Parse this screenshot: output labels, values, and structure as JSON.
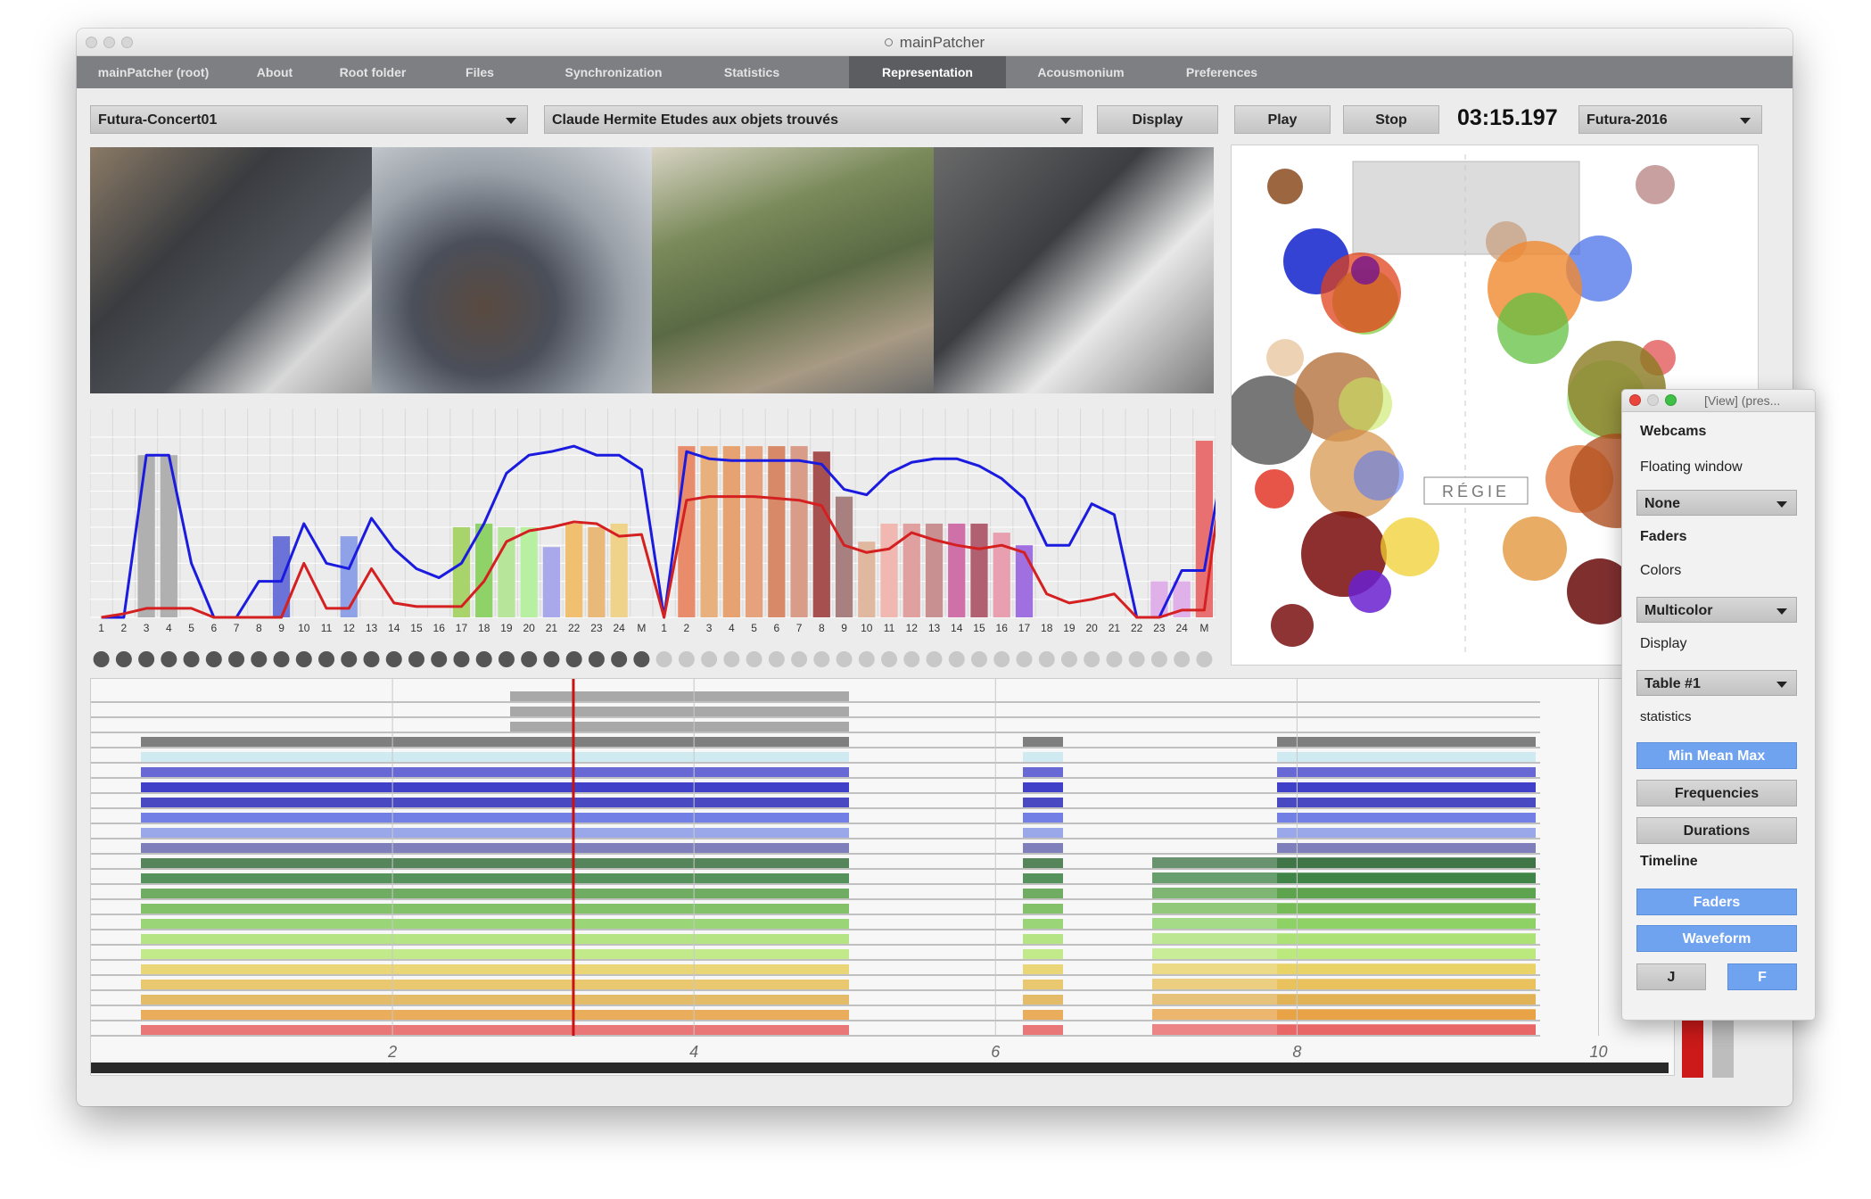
{
  "window": {
    "title": "mainPatcher"
  },
  "tabs": [
    "mainPatcher (root)",
    "About",
    "Root folder",
    "Files",
    "Synchronization",
    "Statistics",
    "Representation",
    "Acousmonium",
    "Preferences"
  ],
  "active_tab": "Representation",
  "toolbar": {
    "concert": "Futura-Concert01",
    "piece": "Claude Hermite Etudes aux objets trouvés",
    "display_label": "Display",
    "play_label": "Play",
    "stop_label": "Stop",
    "time": "03:15.197",
    "festival": "Futura-2016"
  },
  "chart_data": {
    "type": "line",
    "categories": [
      "1",
      "2",
      "3",
      "4",
      "5",
      "6",
      "7",
      "8",
      "9",
      "10",
      "11",
      "12",
      "13",
      "14",
      "15",
      "16",
      "17",
      "18",
      "19",
      "20",
      "21",
      "22",
      "23",
      "24",
      "M",
      "1",
      "2",
      "3",
      "4",
      "5",
      "6",
      "7",
      "8",
      "9",
      "10",
      "11",
      "12",
      "13",
      "14",
      "15",
      "16",
      "17",
      "18",
      "19",
      "20",
      "21",
      "22",
      "23",
      "24",
      "M"
    ],
    "series": [
      {
        "color": "#1b1be0",
        "values": [
          0,
          0,
          0.9,
          0.9,
          0.3,
          0,
          0,
          0.2,
          0.2,
          0.52,
          0.3,
          0.27,
          0.55,
          0.38,
          0.27,
          0.22,
          0.3,
          0.52,
          0.8,
          0.9,
          0.92,
          0.95,
          0.9,
          0.9,
          0.82,
          0,
          0.92,
          0.88,
          0.87,
          0.87,
          0.87,
          0.87,
          0.85,
          0.71,
          0.68,
          0.8,
          0.86,
          0.88,
          0.88,
          0.84,
          0.77,
          0.66,
          0.4,
          0.4,
          0.63,
          0.57,
          0,
          0,
          0.26,
          0.26,
          0.98
        ]
      },
      {
        "color": "#d42020",
        "values": [
          0,
          0.02,
          0.05,
          0.05,
          0.05,
          0,
          0,
          0,
          0,
          0.3,
          0.05,
          0.05,
          0.27,
          0.08,
          0.06,
          0.06,
          0.06,
          0.2,
          0.42,
          0.48,
          0.5,
          0.53,
          0.52,
          0.45,
          0.46,
          0,
          0.65,
          0.67,
          0.67,
          0.67,
          0.66,
          0.65,
          0.62,
          0.4,
          0.36,
          0.38,
          0.47,
          0.43,
          0.4,
          0.38,
          0.4,
          0.36,
          0.13,
          0.08,
          0.1,
          0.13,
          0,
          0,
          0.04,
          0.04,
          0.98
        ]
      }
    ],
    "bars": [
      0,
      0,
      0.9,
      0.9,
      0,
      0,
      0,
      0,
      0.45,
      0,
      0,
      0.45,
      0,
      0,
      0,
      0,
      0.5,
      0.52,
      0.5,
      0.5,
      0.39,
      0.52,
      0.5,
      0.52,
      0,
      0,
      0.95,
      0.95,
      0.95,
      0.95,
      0.95,
      0.95,
      0.92,
      0.67,
      0.42,
      0.52,
      0.52,
      0.52,
      0.52,
      0.52,
      0.47,
      0.4,
      0,
      0,
      0,
      0,
      0,
      0.2,
      0.2,
      0.98
    ],
    "bar_colors": [
      "#aaa",
      "#aaa",
      "#b0b0b0",
      "#b0b0b0",
      "#aaa",
      "#aaa",
      "#aaa",
      "#aaa",
      "#6c73d8",
      "#aaa",
      "#aaa",
      "#8fa2e8",
      "#aaa",
      "#aaa",
      "#aaa",
      "#aaa",
      "#a9d36b",
      "#8fd268",
      "#b7e69a",
      "#b8f0a2",
      "#a8a8ea",
      "#f0c070",
      "#e8b978",
      "#f0d38a",
      "#aaa",
      "#aaa",
      "#e98c6c",
      "#e8b07c",
      "#e6a270",
      "#e6a27c",
      "#d88a68",
      "#d89c88",
      "#a65050",
      "#a88080",
      "#e0b8a0",
      "#f0b8b0",
      "#e0a0a0",
      "#c89090",
      "#d070a8",
      "#b06070",
      "#e8a0b0",
      "#a070e0",
      "#aaa",
      "#aaa",
      "#aaa",
      "#aaa",
      "#aaa",
      "#e0b0e8",
      "#e0b0e8",
      "#e87070"
    ],
    "active_points": 25,
    "ylim": [
      0,
      1
    ]
  },
  "map": {
    "label": "RÉGIE"
  },
  "timeline": {
    "ticks": [
      "2",
      "4",
      "6",
      "8",
      "10"
    ],
    "playhead_seconds": 3.2,
    "x_range": [
      0,
      10.5
    ]
  },
  "panel": {
    "title": "[View] (pres...",
    "webcams_heading": "Webcams",
    "floating_label": "Floating window",
    "floating_value": "None",
    "faders_heading": "Faders",
    "colors_label": "Colors",
    "colors_value": "Multicolor",
    "display_label": "Display",
    "display_value": "Table #1",
    "statistics_label": "statistics",
    "btn_minmeanmax": "Min Mean Max",
    "btn_frequencies": "Frequencies",
    "btn_durations": "Durations",
    "timeline_heading": "Timeline",
    "btn_faders": "Faders",
    "btn_waveform": "Waveform",
    "btn_j": "J",
    "btn_f": "F"
  },
  "colors": {
    "tabbar": "#7d7f83",
    "active_tab": "#5b5d61",
    "accent_blue": "#6fa2ef",
    "playhead": "#cc1111"
  }
}
